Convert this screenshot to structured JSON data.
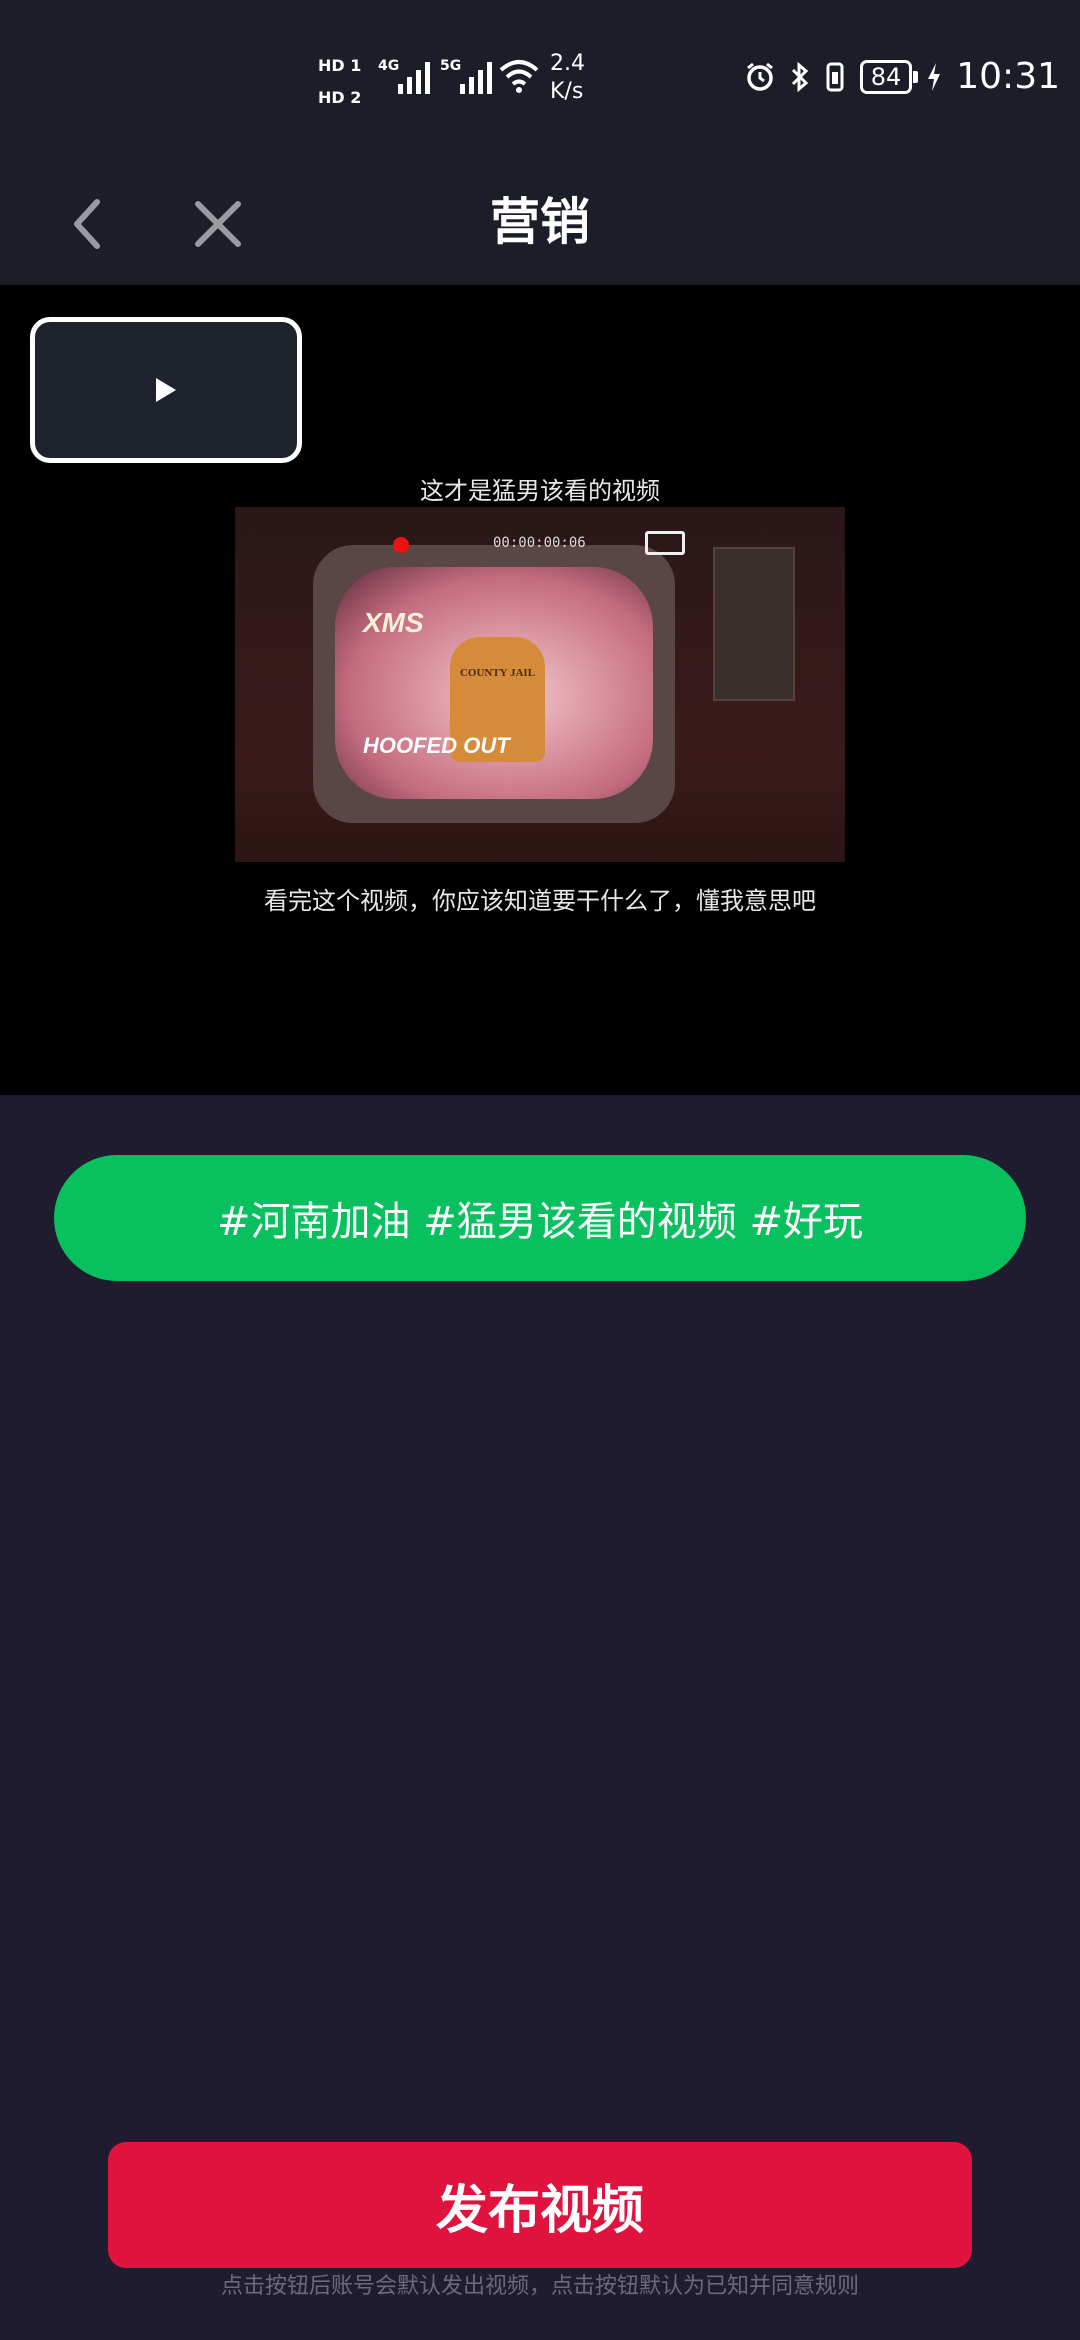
{
  "status_bar": {
    "hd1": "HD 1",
    "hd2": "HD 2",
    "sig1": "4G",
    "sig2": "5G",
    "speed_value": "2.4",
    "speed_unit": "K/s",
    "battery": "84",
    "time": "10:31",
    "icons": [
      "alarm-icon",
      "bluetooth-icon",
      "vibrate-icon",
      "charging-icon",
      "wifi-icon"
    ]
  },
  "header": {
    "title": "营销"
  },
  "video": {
    "caption_top": "这才是猛男该看的视频",
    "caption_bottom": "看完这个视频，你应该知道要干什么了，懂我意思吧",
    "frame_logo": "XMS",
    "frame_text": "HOOFED OUT",
    "timecode": "00:00:00:06",
    "sign_text": "COUNTY JAIL"
  },
  "hashtag_button": {
    "label": "#河南加油 #猛男该看的视频 #好玩"
  },
  "publish": {
    "label": "发布视频",
    "notice": "点击按钮后账号会默认发出视频，点击按钮默认为已知并同意规则"
  },
  "colors": {
    "hashtag_bg": "#09c05e",
    "publish_bg": "#e0123e",
    "page_bg": "#1e1c2e"
  }
}
